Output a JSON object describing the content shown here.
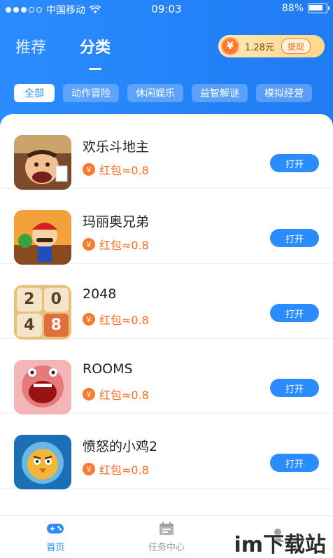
{
  "status_bar": {
    "carrier": "中国移动",
    "time": "09:03",
    "battery": "88%",
    "battery_level": 0.88
  },
  "header": {
    "tabs": [
      {
        "label": "推荐",
        "active": false
      },
      {
        "label": "分类",
        "active": true
      }
    ],
    "wallet": {
      "coin_symbol": "¥",
      "amount": "1.28元",
      "withdraw_label": "提现"
    },
    "categories": [
      {
        "label": "全部",
        "active": true
      },
      {
        "label": "动作冒险",
        "active": false
      },
      {
        "label": "休闲娱乐",
        "active": false
      },
      {
        "label": "益智解谜",
        "active": false
      },
      {
        "label": "模拟经营",
        "active": false
      }
    ]
  },
  "games": [
    {
      "title": "欢乐斗地主",
      "reward": "红包≈0.8",
      "button": "打开",
      "icon": "doudizhu-icon"
    },
    {
      "title": "玛丽奥兄弟",
      "reward": "红包≈0.8",
      "button": "打开",
      "icon": "mario-icon"
    },
    {
      "title": "2048",
      "reward": "红包≈0.8",
      "button": "打开",
      "icon": "tiles-2048-icon",
      "tiles": [
        "2",
        "0",
        "4",
        "8"
      ]
    },
    {
      "title": "ROOMS",
      "reward": "红包≈0.8",
      "button": "打开",
      "icon": "rooms-monster-icon"
    },
    {
      "title": "愤怒的小鸡2",
      "reward": "红包≈0.8",
      "button": "打开",
      "icon": "angry-chick-icon"
    }
  ],
  "bottom_nav": [
    {
      "label": "首页",
      "active": true,
      "icon": "gamepad-icon"
    },
    {
      "label": "任务中心",
      "active": false,
      "icon": "calendar-icon"
    },
    {
      "label": "",
      "active": false,
      "icon": "profile-icon"
    }
  ],
  "watermark": "im下载站",
  "colors": {
    "primary": "#2a8cff",
    "reward": "#ff6a1b",
    "coin": "#ff7a2e"
  }
}
